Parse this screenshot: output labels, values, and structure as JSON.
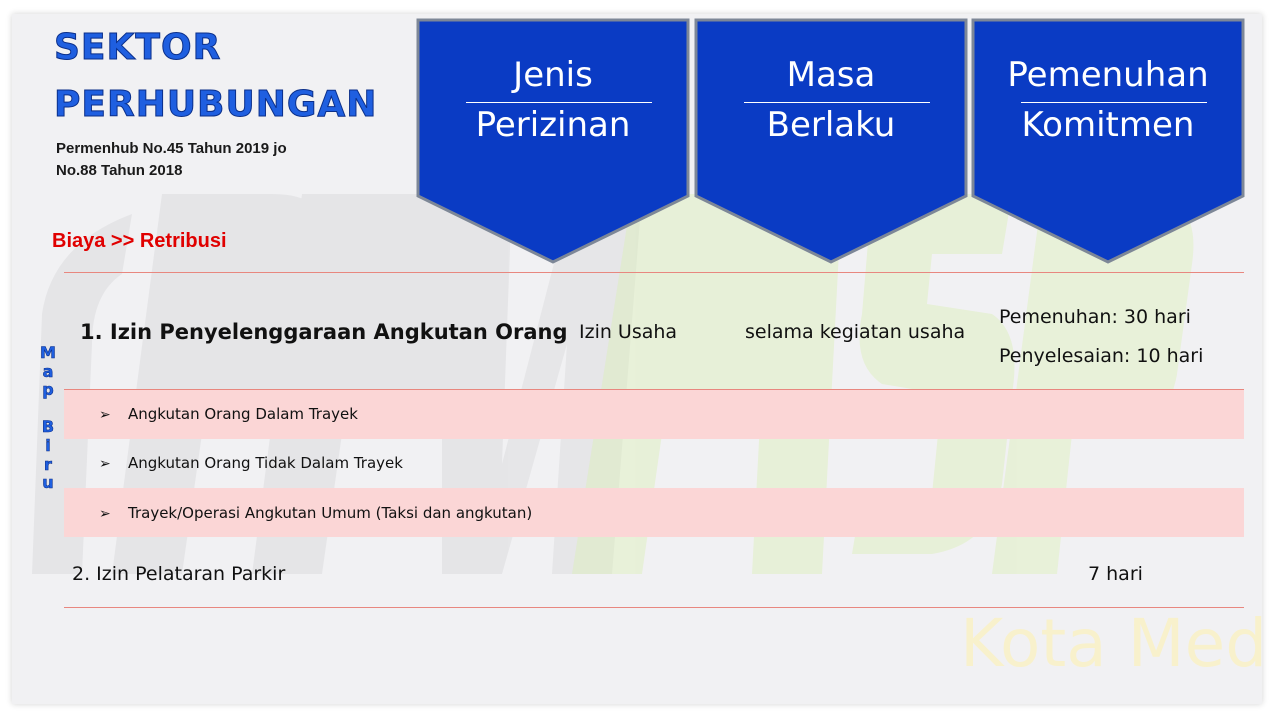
{
  "title": {
    "line1": "SEKTOR",
    "line2": "PERHUBUNGAN"
  },
  "regulation": {
    "line1": "Permenhub No.45 Tahun 2019 jo",
    "line2": "No.88 Tahun 2018"
  },
  "biaya_label": "Biaya >> Retribusi",
  "vertical_label": [
    "M",
    "a",
    "p",
    "",
    "B",
    "i",
    "r",
    "u"
  ],
  "headers": [
    {
      "line1": "Jenis",
      "line2": "Perizinan"
    },
    {
      "line1": "Masa",
      "line2": "Berlaku"
    },
    {
      "line1": "Pemenuhan",
      "line2": "Komitmen"
    }
  ],
  "items": {
    "item1": {
      "name": "1.  Izin Penyelenggaraan Angkutan Orang",
      "jenis": "Izin Usaha",
      "masa": "selama kegiatan usaha",
      "pemenuhan": "Pemenuhan:  30 hari",
      "penyelesaian": "Penyelesaian: 10 hari"
    },
    "subitems": [
      "Angkutan Orang Dalam Trayek",
      "Angkutan Orang Tidak Dalam Trayek",
      "Trayek/Operasi Angkutan Umum (Taksi dan angkutan)"
    ],
    "bullet_icon": "arrowhead-bullet-icon",
    "item2": {
      "name": "2.  Izin Pelataran Parkir",
      "value": "7 hari"
    }
  },
  "watermark": {
    "text": "Kota Medan"
  },
  "colors": {
    "header_fill": "#0a3bc4",
    "title_blue": "#1f5fe0",
    "biaya_red": "#e00000",
    "band_pink": "#fbd6d6",
    "rule_red": "#e8877f"
  }
}
